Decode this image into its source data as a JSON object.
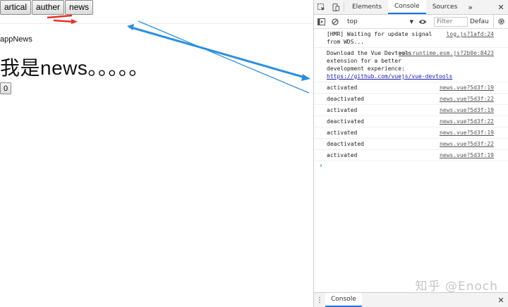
{
  "app": {
    "nav": [
      "artical",
      "auther",
      "news"
    ],
    "app_name": "appNews",
    "title": "我是news。。。。。",
    "counter": "0"
  },
  "devtools": {
    "tabs": [
      "Elements",
      "Console",
      "Sources"
    ],
    "active_tab": "Console",
    "more": "»",
    "context": "top",
    "filter_placeholder": "Filter",
    "levels": "Defau",
    "messages": [
      {
        "text": "[HMR] Waiting for update signal from WDS...",
        "source": "log.js?1afd:24"
      },
      {
        "text": "Download the Vue Devtools extension for a better development experience:",
        "link": "https://github.com/vuejs/vue-devtools",
        "source": "vue.runtime.esm.js?2b0e:8423"
      },
      {
        "text": "activated",
        "source": "news.vue?5d3f:19"
      },
      {
        "text": "deactivated",
        "source": "news.vue?5d3f:22"
      },
      {
        "text": "activated",
        "source": "news.vue?5d3f:19"
      },
      {
        "text": "deactivated",
        "source": "news.vue?5d3f:22"
      },
      {
        "text": "activated",
        "source": "news.vue?5d3f:19"
      },
      {
        "text": "deactivated",
        "source": "news.vue?5d3f:22"
      },
      {
        "text": "activated",
        "source": "news.vue?5d3f:19"
      }
    ],
    "prompt": "›",
    "drawer_tab": "Console"
  },
  "watermark": "知乎 @Enoch",
  "colors": {
    "red_arrow": "#e8302a",
    "blue_arrow": "#2b8fe0",
    "link_blue": "#1a1aa6"
  }
}
